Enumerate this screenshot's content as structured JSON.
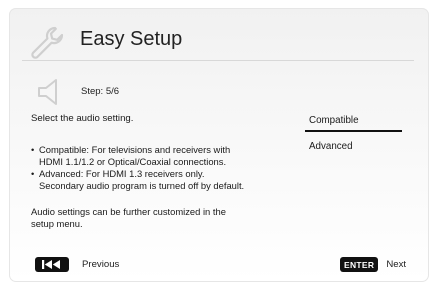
{
  "header": {
    "title": "Easy Setup",
    "icon": "wrench-icon"
  },
  "step": {
    "label": "Step: 5/6",
    "icon": "speaker-icon"
  },
  "prompt": "Select the audio setting.",
  "descriptions": {
    "compatible_line1": "Compatible: For televisions and receivers with",
    "compatible_line2": "HDMI 1.1/1.2 or Optical/Coaxial connections.",
    "advanced_line1": "Advanced: For HDMI 1.3 receivers only.",
    "advanced_line2": "Secondary audio program is turned off by default."
  },
  "note": {
    "line1": "Audio settings can be further customized in the",
    "line2": "setup menu."
  },
  "options": [
    {
      "label": "Compatible",
      "selected": true
    },
    {
      "label": "Advanced",
      "selected": false
    }
  ],
  "footer": {
    "prev_label": "Previous",
    "prev_key_icon": "skip-back-icon",
    "enter_key": "ENTER",
    "next_label": "Next"
  },
  "colors": {
    "background_top": "#f1f1f1",
    "text": "#1a1a1a",
    "key_bg": "#111111"
  }
}
